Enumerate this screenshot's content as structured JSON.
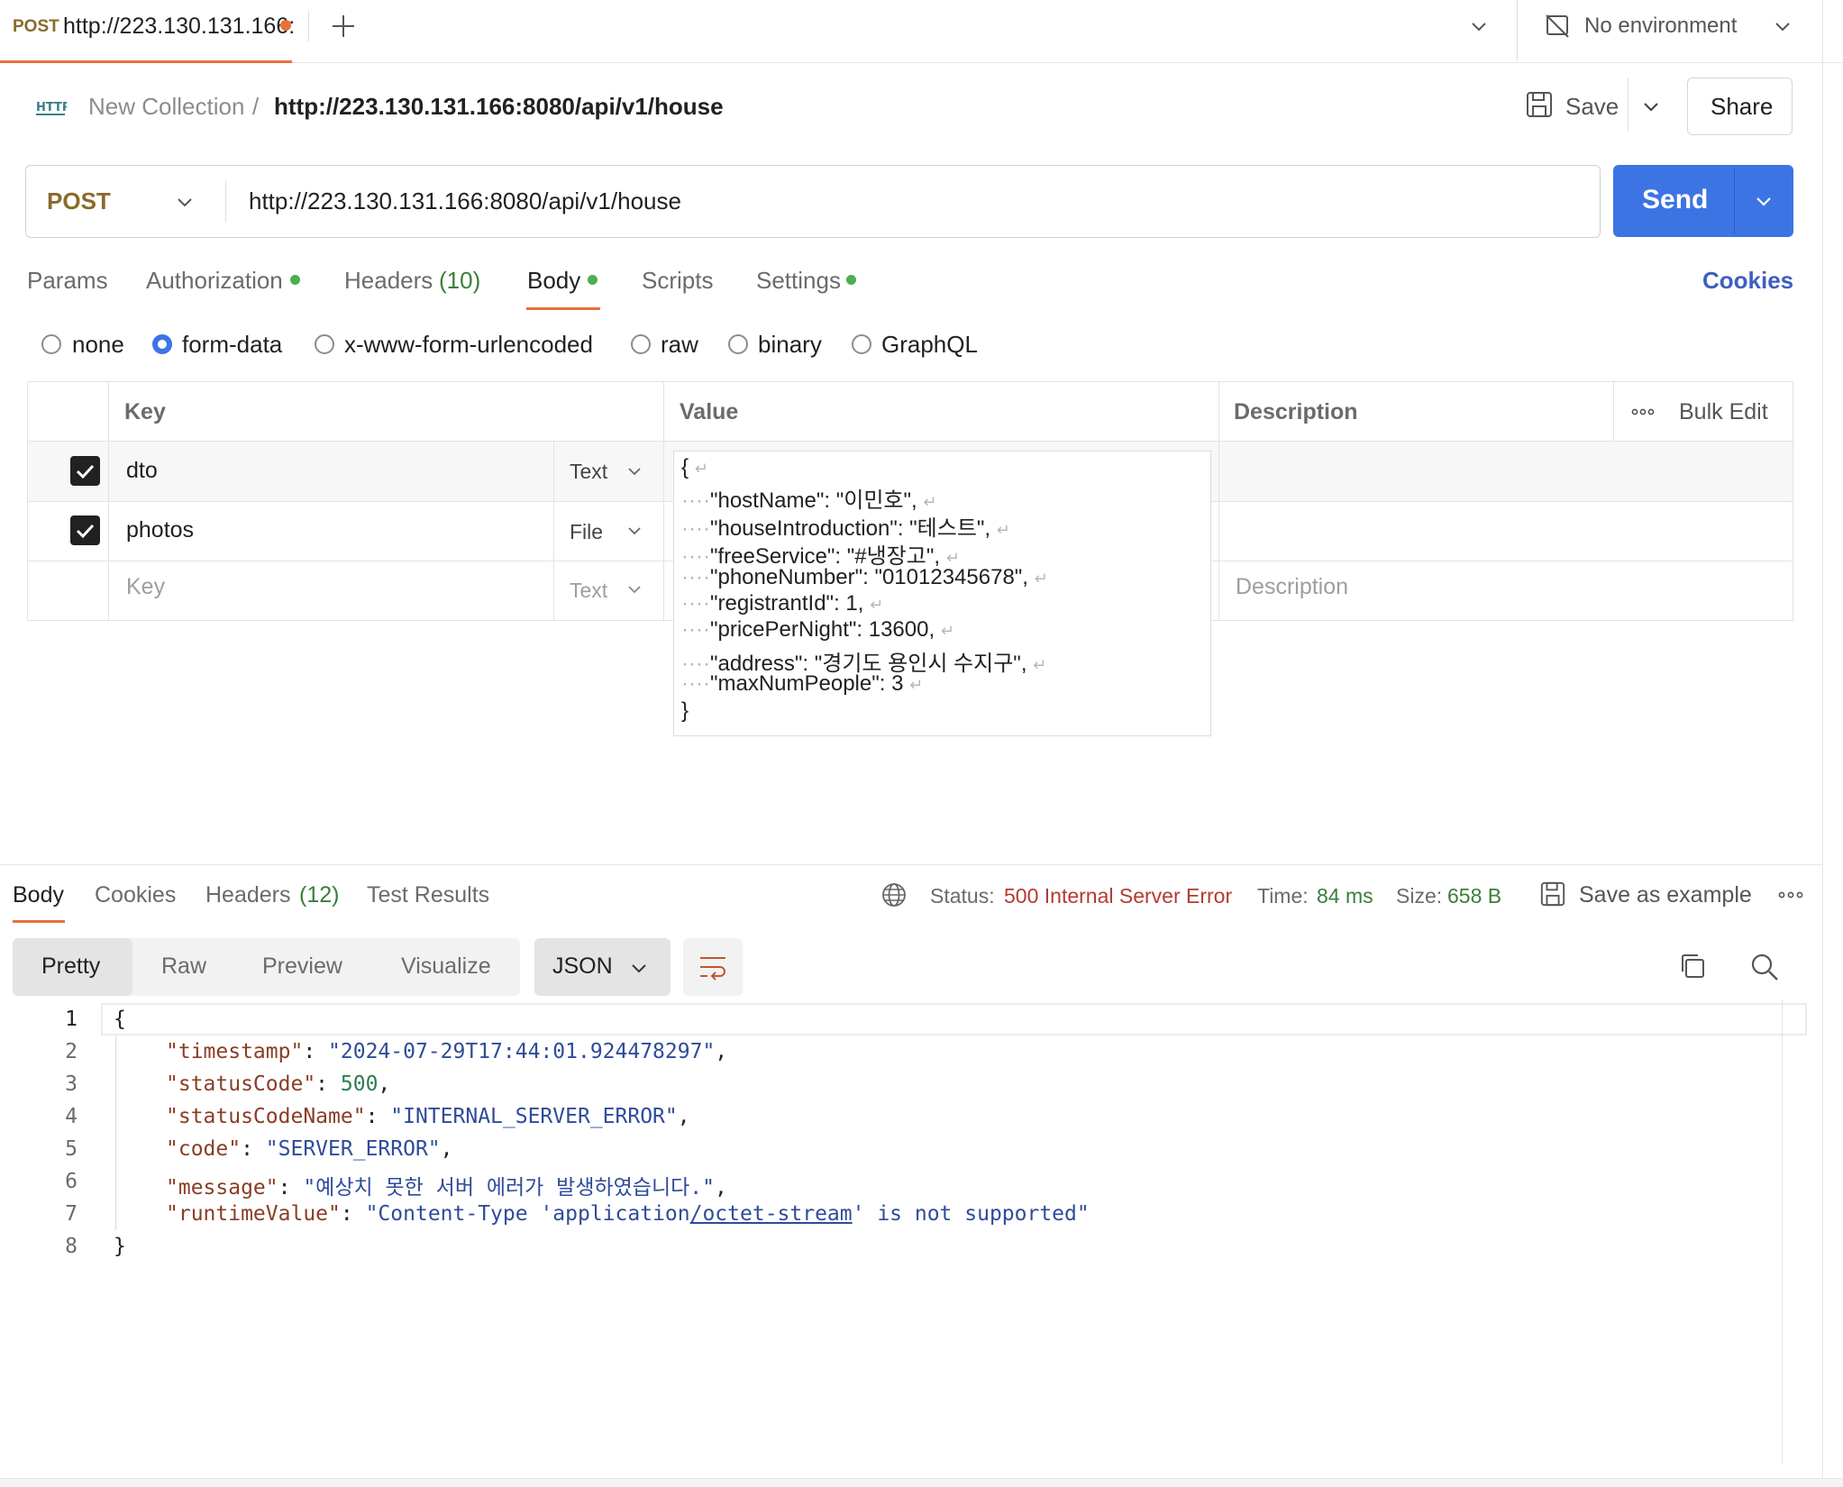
{
  "tab": {
    "method": "POST",
    "url": "http://223.130.131.166:"
  },
  "environment": {
    "label": "No environment"
  },
  "breadcrumb": {
    "collection": "New Collection",
    "separator": "/",
    "request": "http://223.130.131.166:8080/api/v1/house"
  },
  "actions": {
    "save": "Save",
    "share": "Share"
  },
  "request": {
    "method": "POST",
    "url": "http://223.130.131.166:8080/api/v1/house",
    "send": "Send"
  },
  "request_tabs": {
    "params": "Params",
    "authorization": "Authorization",
    "headers": "Headers",
    "headers_count": "(10)",
    "body": "Body",
    "scripts": "Scripts",
    "settings": "Settings",
    "cookies": "Cookies"
  },
  "body_types": {
    "none": "none",
    "form_data": "form-data",
    "urlencoded": "x-www-form-urlencoded",
    "raw": "raw",
    "binary": "binary",
    "graphql": "GraphQL",
    "selected": "form-data"
  },
  "table": {
    "headers": {
      "key": "Key",
      "value": "Value",
      "description": "Description",
      "bulk_edit": "Bulk Edit"
    },
    "rows": [
      {
        "checked": true,
        "key": "dto",
        "type": "Text"
      },
      {
        "checked": true,
        "key": "photos",
        "type": "File"
      }
    ],
    "empty_row": {
      "key_placeholder": "Key",
      "type": "Text",
      "description_placeholder": "Description"
    }
  },
  "dto_value_lines": [
    "{",
    "\"hostName\": \"이민호\",",
    "\"houseIntroduction\": \"테스트\",",
    "\"freeService\": \"#냉장고\",",
    "\"phoneNumber\": \"01012345678\",",
    "\"registrantId\": 1,",
    "\"pricePerNight\": 13600,",
    "\"address\": \"경기도 용인시 수지구\",",
    "\"maxNumPeople\": 3",
    "}"
  ],
  "response": {
    "tabs": {
      "body": "Body",
      "cookies": "Cookies",
      "headers": "Headers",
      "headers_count": "(12)",
      "tests": "Test Results"
    },
    "status_label": "Status:",
    "status_value": "500 Internal Server Error",
    "time_label": "Time:",
    "time_value": "84 ms",
    "size_label": "Size:",
    "size_value": "658 B",
    "save_example": "Save as example",
    "views": {
      "pretty": "Pretty",
      "raw": "Raw",
      "preview": "Preview",
      "visualize": "Visualize"
    },
    "format": "JSON",
    "line_numbers": [
      "1",
      "2",
      "3",
      "4",
      "5",
      "6",
      "7",
      "8"
    ],
    "json": {
      "open": "{",
      "close": "}",
      "timestamp_key": "\"timestamp\"",
      "timestamp_val": "\"2024-07-29T17:44:01.924478297\"",
      "statusCode_key": "\"statusCode\"",
      "statusCode_val": "500",
      "statusCodeName_key": "\"statusCodeName\"",
      "statusCodeName_val": "\"INTERNAL_SERVER_ERROR\"",
      "code_key": "\"code\"",
      "code_val": "\"SERVER_ERROR\"",
      "message_key": "\"message\"",
      "message_val": "\"예상치 못한 서버 에러가 발생하였습니다.\"",
      "runtime_key": "\"runtimeValue\"",
      "runtime_val_a": "\"Content-Type 'application",
      "runtime_val_b": "/octet-stream",
      "runtime_val_c": "' is not supported\""
    }
  }
}
